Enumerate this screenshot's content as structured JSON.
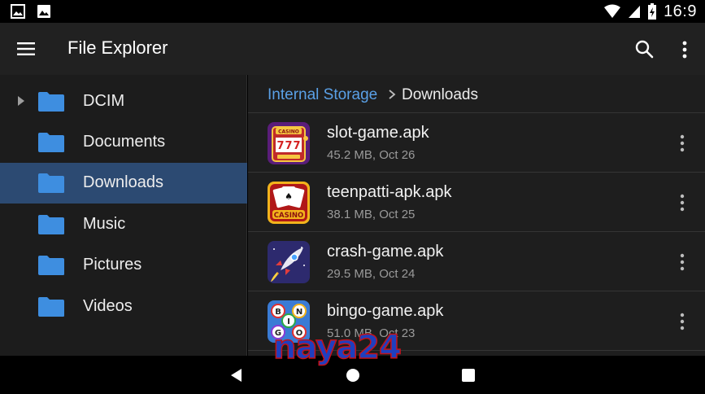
{
  "status_bar": {
    "left_icons": [
      "image-icon",
      "photo-icon"
    ],
    "right_icons": [
      "wifi-icon",
      "signal-icon",
      "battery-icon"
    ],
    "time": "16:9"
  },
  "app_bar": {
    "menu_icon": "menu-icon",
    "title": "File Explorer",
    "search_icon": "search-icon",
    "more_icon": "more-vert-icon"
  },
  "sidebar": {
    "items": [
      {
        "label": "DCIM",
        "icon": "folder-icon",
        "expandable": true
      },
      {
        "label": "Documents",
        "icon": "folder-icon"
      },
      {
        "label": "Downloads",
        "icon": "folder-icon",
        "selected": true
      },
      {
        "label": "Music",
        "icon": "folder-icon"
      },
      {
        "label": "Pictures",
        "icon": "folder-icon"
      },
      {
        "label": "Videos",
        "icon": "folder-icon"
      }
    ]
  },
  "breadcrumb": {
    "root": "Internal Storage",
    "separator_icon": "chevron-right-icon",
    "current": "Downloads"
  },
  "files": [
    {
      "name": "slot-game.apk",
      "meta": "45.2 MB, Oct 26",
      "icon": "slot-machine-icon",
      "icon_text": "CASINO"
    },
    {
      "name": "teenpatti-apk.apk",
      "meta": "38.1 MB, Oct 25",
      "icon": "playing-cards-icon",
      "icon_text": "CASINO"
    },
    {
      "name": "crash-game.apk",
      "meta": "29.5 MB, Oct 24",
      "icon": "rocket-icon"
    },
    {
      "name": "bingo-game.apk",
      "meta": "51.0 MB, Oct 23",
      "icon": "bingo-balls-icon",
      "icon_text": "BINGO"
    }
  ],
  "nav_bar": {
    "back_icon": "back-triangle-icon",
    "home_icon": "home-circle-icon",
    "recents_icon": "recents-square-icon"
  },
  "watermark": "naya24",
  "colors": {
    "accent": "#5aa0e6",
    "folder": "#3e8ee0",
    "selected_row": "#2c4a72",
    "app_bar": "#212121",
    "watermark_fill": "#1f3fbf",
    "watermark_stroke": "#c4121b"
  }
}
